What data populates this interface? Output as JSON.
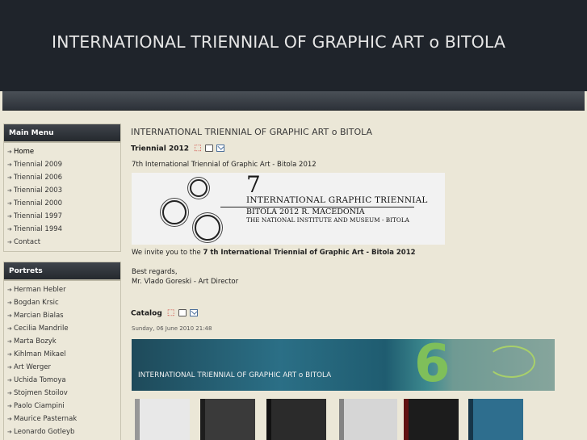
{
  "header": {
    "title": "INTERNATIONAL TRIENNIAL OF GRAPHIC ART o BITOLA"
  },
  "main_menu": {
    "title": "Main Menu",
    "items": [
      "Home",
      "Triennial 2009",
      "Triennial 2006",
      "Triennial 2003",
      "Triennial 2000",
      "Triennial 1997",
      "Triennial 1994",
      "Contact"
    ]
  },
  "portrets": {
    "title": "Portrets",
    "items": [
      "Herman Hebler",
      "Bogdan Krsic",
      "Marcian Bialas",
      "Cecilia Mandrile",
      "Marta Bozyk",
      "Kihlman Mikael",
      "Art Werger",
      "Uchida Tomoya",
      "Stojmen Stoilov",
      "Paolo Ciampini",
      "Maurice Pasternak",
      "Leonardo Gotleyb"
    ]
  },
  "content": {
    "title": "INTERNATIONAL TRIENNIAL OF GRAPHIC ART o BITOLA",
    "article1": {
      "heading": "Triennial 2012",
      "intro": "7th International Triennial of Graphic Art - Bitola 2012",
      "banner": {
        "number": "7",
        "line1": "INTERNATIONAL GRAPHIC TRIENNIAL",
        "line2": "BITOLA 2012 R. MACEDONIA",
        "line3": "THE NATIONAL INSTITUTE AND MUSEUM - BITOLA"
      },
      "invite_prefix": "We invite you to the ",
      "invite_bold": "7 th International Triennial of Graphic Art - Bitola 2012",
      "regards": "Best regards,",
      "signature": "Mr. Vlado Goreski - Art Director"
    },
    "article2": {
      "heading": "Catalog",
      "date": "Sunday, 06 June 2010 21:48",
      "banner_text": "INTERNATIONAL TRIENNIAL OF GRAPHIC ART o BITOLA",
      "banner_number": "6"
    }
  },
  "icons": {
    "pdf": "pdf-icon",
    "print": "print-icon",
    "email": "email-icon"
  },
  "colors": {
    "header_bg": "#1f242b",
    "page_bg": "#ebe7d7",
    "menu_head": "#2d3239"
  }
}
